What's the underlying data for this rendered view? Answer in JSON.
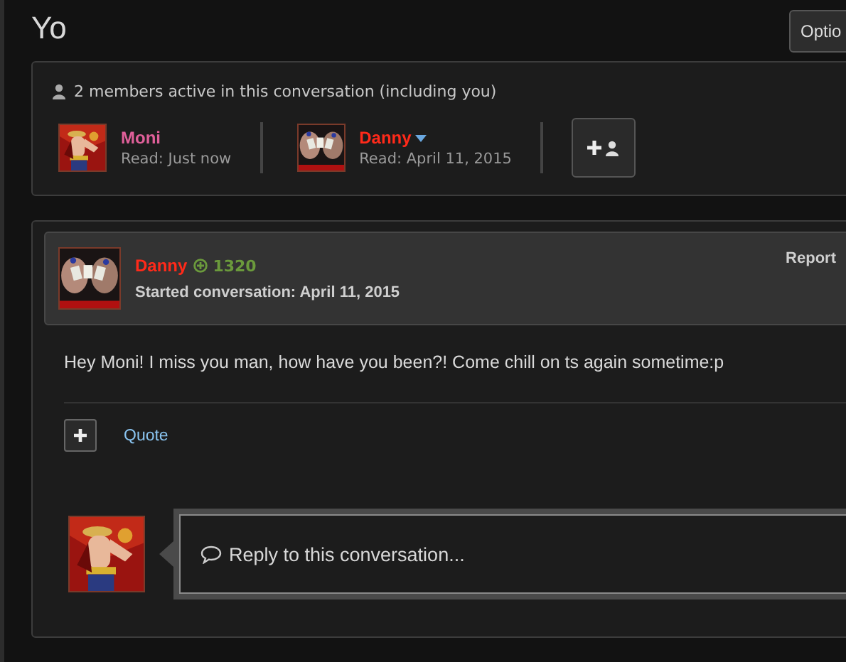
{
  "title": "Yo",
  "options_button": "Optio",
  "members": {
    "summary": "2 members active in this conversation (including you)",
    "list": [
      {
        "name": "Moni",
        "color": "#e0609a",
        "read": "Read: Just now",
        "has_menu": false
      },
      {
        "name": "Danny",
        "color": "#ff2a1a",
        "read": "Read: April 11, 2015",
        "has_menu": true
      }
    ]
  },
  "post": {
    "author": "Danny",
    "points": "1320",
    "started": "Started conversation: April 11, 2015",
    "report": "Report",
    "message": "Hey Moni! I miss you man, how have you been?! Come chill on ts again sometime:p",
    "quote": "Quote"
  },
  "reply": {
    "placeholder": "Reply to this conversation..."
  }
}
